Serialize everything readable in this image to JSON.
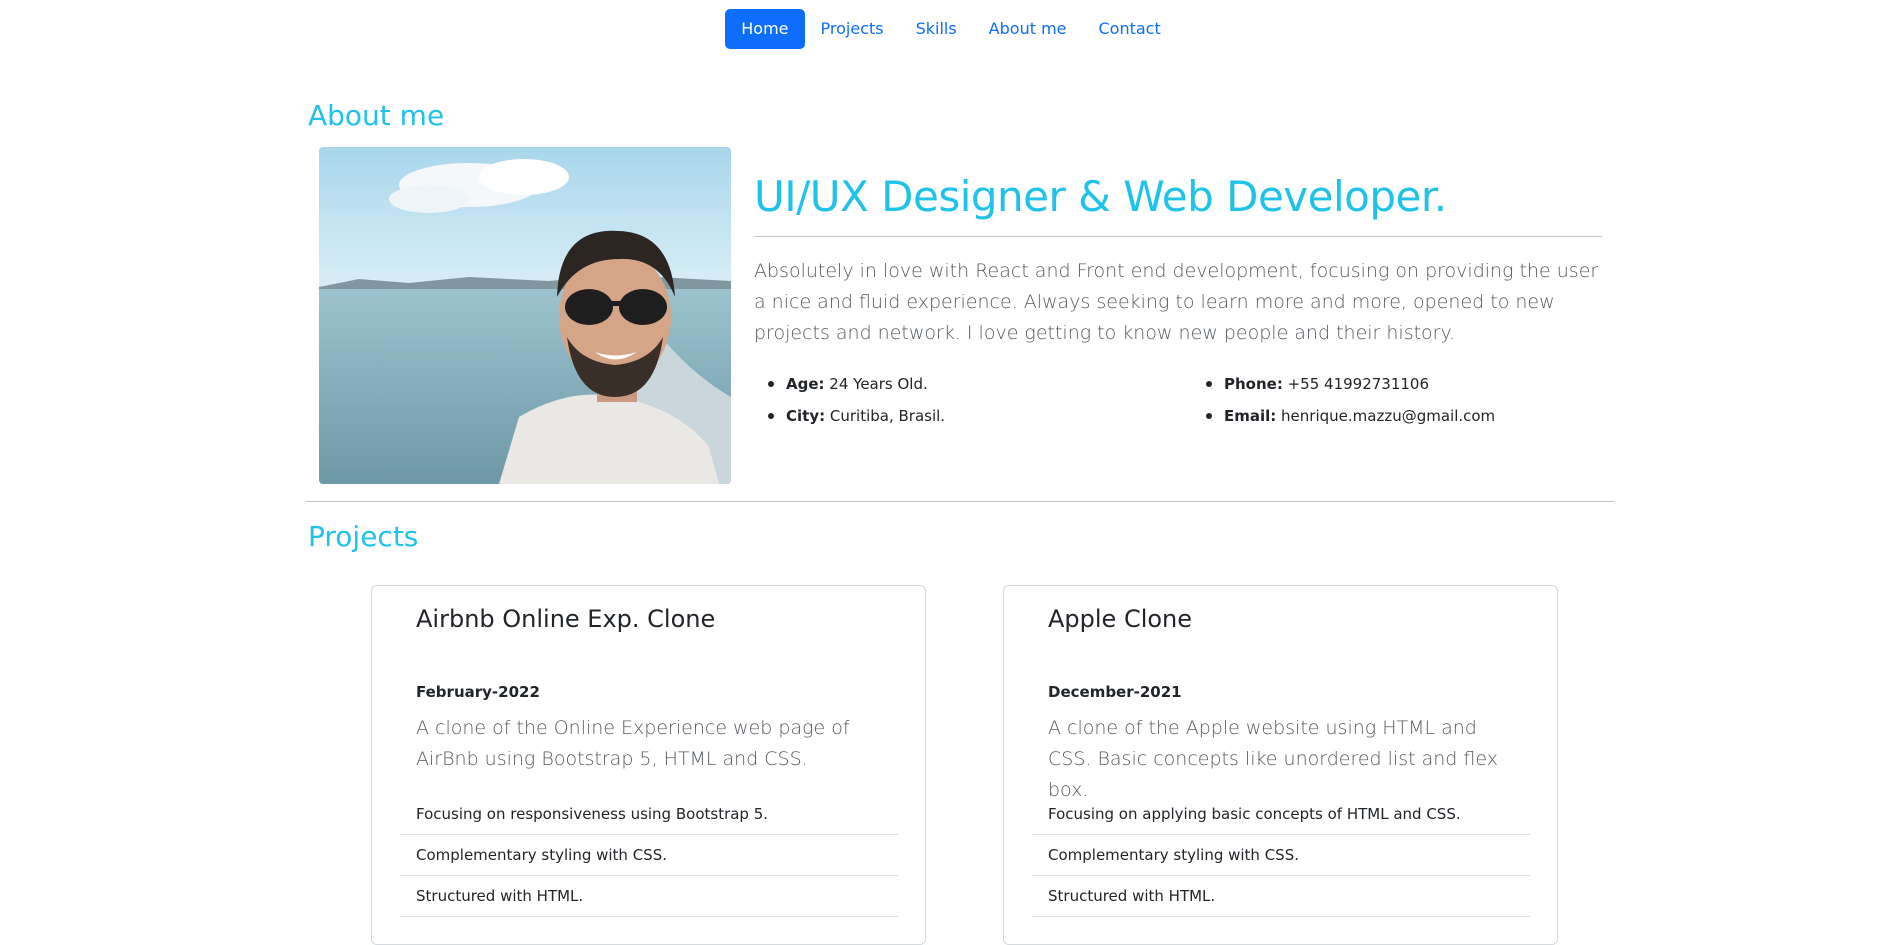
{
  "nav": {
    "items": [
      {
        "label": "Home",
        "active": true
      },
      {
        "label": "Projects",
        "active": false
      },
      {
        "label": "Skills",
        "active": false
      },
      {
        "label": "About me",
        "active": false
      },
      {
        "label": "Contact",
        "active": false
      }
    ]
  },
  "about": {
    "section_title": "About me",
    "headline": "UI/UX Designer & Web Developer.",
    "bio": "Absolutely in love with React and Front end development, focusing on providing the user a nice and fluid experience. Always seeking to learn more and more, opened to new projects and network. I love getting to know new people and their history.",
    "facts_left": [
      {
        "label": "Age:",
        "value": " 24 Years Old."
      },
      {
        "label": "City:",
        "value": " Curitiba, Brasil."
      }
    ],
    "facts_right": [
      {
        "label": "Phone:",
        "value": " +55 41992731106"
      },
      {
        "label": "Email:",
        "value": " henrique.mazzu@gmail.com"
      }
    ]
  },
  "projects": {
    "section_title": "Projects",
    "cards": [
      {
        "title": "Airbnb Online Exp. Clone",
        "date": "February-2022",
        "description": "A clone of the Online Experience web page of AirBnb using Bootstrap 5, HTML and CSS.",
        "points": [
          "Focusing on responsiveness using Bootstrap 5.",
          "Complementary styling with CSS.",
          "Structured with HTML."
        ]
      },
      {
        "title": "Apple Clone",
        "date": "December-2021",
        "description": "A clone of the Apple website using HTML and CSS. Basic concepts like unordered list and flex box.",
        "points": [
          "Focusing on applying basic concepts of HTML and CSS.",
          "Complementary styling with CSS.",
          "Structured with HTML."
        ]
      }
    ]
  },
  "colors": {
    "accent": "#1fc3ea",
    "primary": "#0d6efd"
  }
}
